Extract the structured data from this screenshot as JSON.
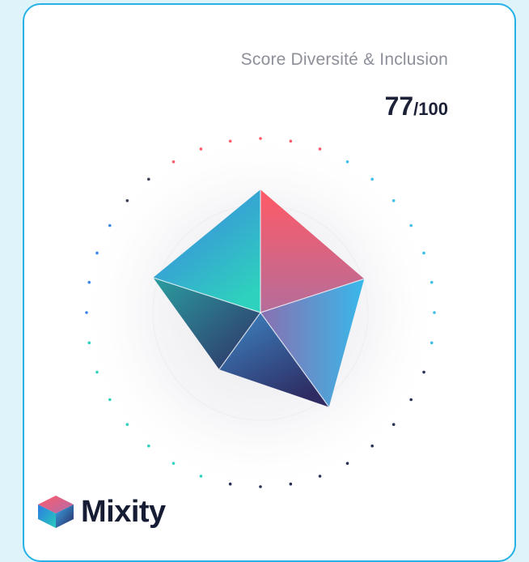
{
  "score": {
    "label": "Score Diversité & Inclusion",
    "value": "77",
    "max": "/100"
  },
  "chart_data": {
    "type": "radar",
    "score": 77,
    "max": 100,
    "axes": 5,
    "values": [
      0.98,
      0.87,
      0.93,
      0.56,
      0.9
    ],
    "gradient_colors": [
      "#ff5a6a",
      "#3c8ee8",
      "#32c6e8",
      "#2dd4b8",
      "#3a2f73"
    ]
  },
  "brand": {
    "name": "Mixity",
    "logo_icon": "mixity-cube-logo-icon"
  }
}
